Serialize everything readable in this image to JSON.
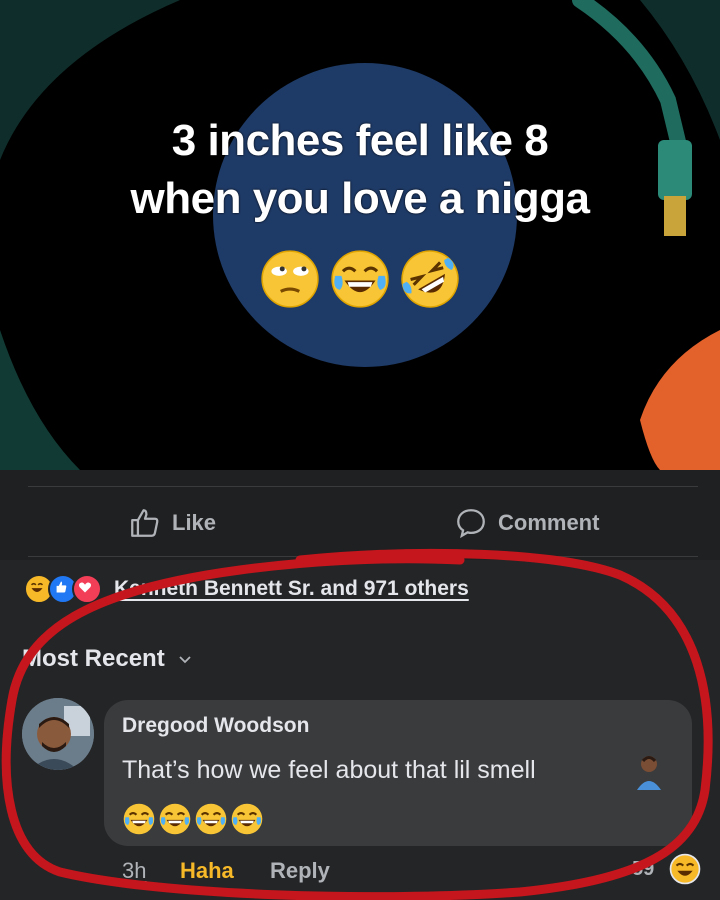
{
  "post": {
    "meme_line1": "3 inches feel like 8",
    "meme_line2": "when you love a nigga",
    "meme_emojis": [
      "rolling-eyes-face",
      "tears-of-joy-face",
      "rolling-on-floor-laughing-face"
    ],
    "colors": {
      "background": "#000000",
      "record_label": "#1e3a66",
      "teal": "#1f6b5e",
      "orange": "#e3612a"
    }
  },
  "actions": {
    "like": "Like",
    "comment": "Comment"
  },
  "reactions": {
    "icons": [
      "haha",
      "like",
      "love"
    ],
    "summary": "Kenneth Bennett Sr. and 971 others"
  },
  "sort": {
    "label": "Most Recent"
  },
  "comment": {
    "author": "Dregood Woodson",
    "text": "That’s how we feel about that lil smell",
    "trailing_emoji_count": 4,
    "time": "3h",
    "reaction_label": "Haha",
    "reply_label": "Reply",
    "reaction_count": "59"
  },
  "theme": {
    "bg": "#242526",
    "text": "#e4e6eb",
    "muted": "#b0b3b8",
    "bubble": "#3a3b3c",
    "haha": "#f7b928",
    "marker_red": "#c4161c"
  }
}
